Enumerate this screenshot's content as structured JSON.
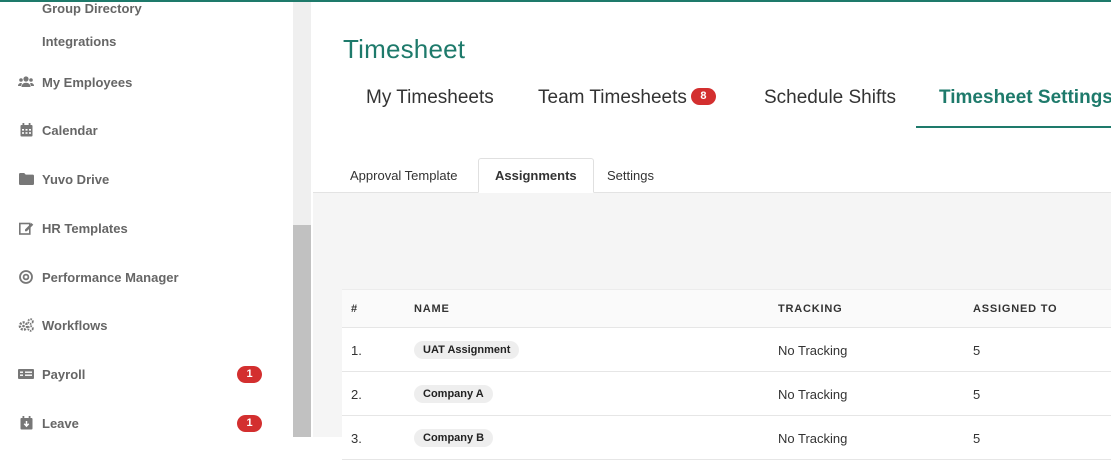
{
  "colors": {
    "brand": "#1e7a6b",
    "badge": "#d32f2f"
  },
  "sidebar": {
    "sub_items": [
      {
        "label": "Group Directory"
      },
      {
        "label": "Integrations"
      }
    ],
    "items": [
      {
        "label": "My Employees",
        "icon": "users-icon"
      },
      {
        "label": "Calendar",
        "icon": "calendar-icon"
      },
      {
        "label": "Yuvo Drive",
        "icon": "folder-icon"
      },
      {
        "label": "HR Templates",
        "icon": "edit-icon"
      },
      {
        "label": "Performance Manager",
        "icon": "target-icon"
      },
      {
        "label": "Workflows",
        "icon": "gears-icon"
      },
      {
        "label": "Payroll",
        "icon": "money-icon",
        "badge": "1"
      },
      {
        "label": "Leave",
        "icon": "leave-icon",
        "badge": "1"
      }
    ]
  },
  "main": {
    "title": "Timesheet",
    "tabs": [
      {
        "label": "My Timesheets"
      },
      {
        "label": "Team Timesheets",
        "badge": "8"
      },
      {
        "label": "Schedule Shifts"
      },
      {
        "label": "Timesheet Settings",
        "active": true
      }
    ],
    "subtabs": [
      {
        "label": "Approval Template"
      },
      {
        "label": "Assignments",
        "active": true
      },
      {
        "label": "Settings"
      }
    ],
    "table": {
      "headers": [
        "#",
        "NAME",
        "TRACKING",
        "ASSIGNED TO"
      ],
      "rows": [
        {
          "num": "1.",
          "name": "UAT Assignment",
          "tracking": "No Tracking",
          "assigned": "5"
        },
        {
          "num": "2.",
          "name": "Company A",
          "tracking": "No Tracking",
          "assigned": "5"
        },
        {
          "num": "3.",
          "name": "Company B",
          "tracking": "No Tracking",
          "assigned": "5"
        }
      ]
    }
  }
}
